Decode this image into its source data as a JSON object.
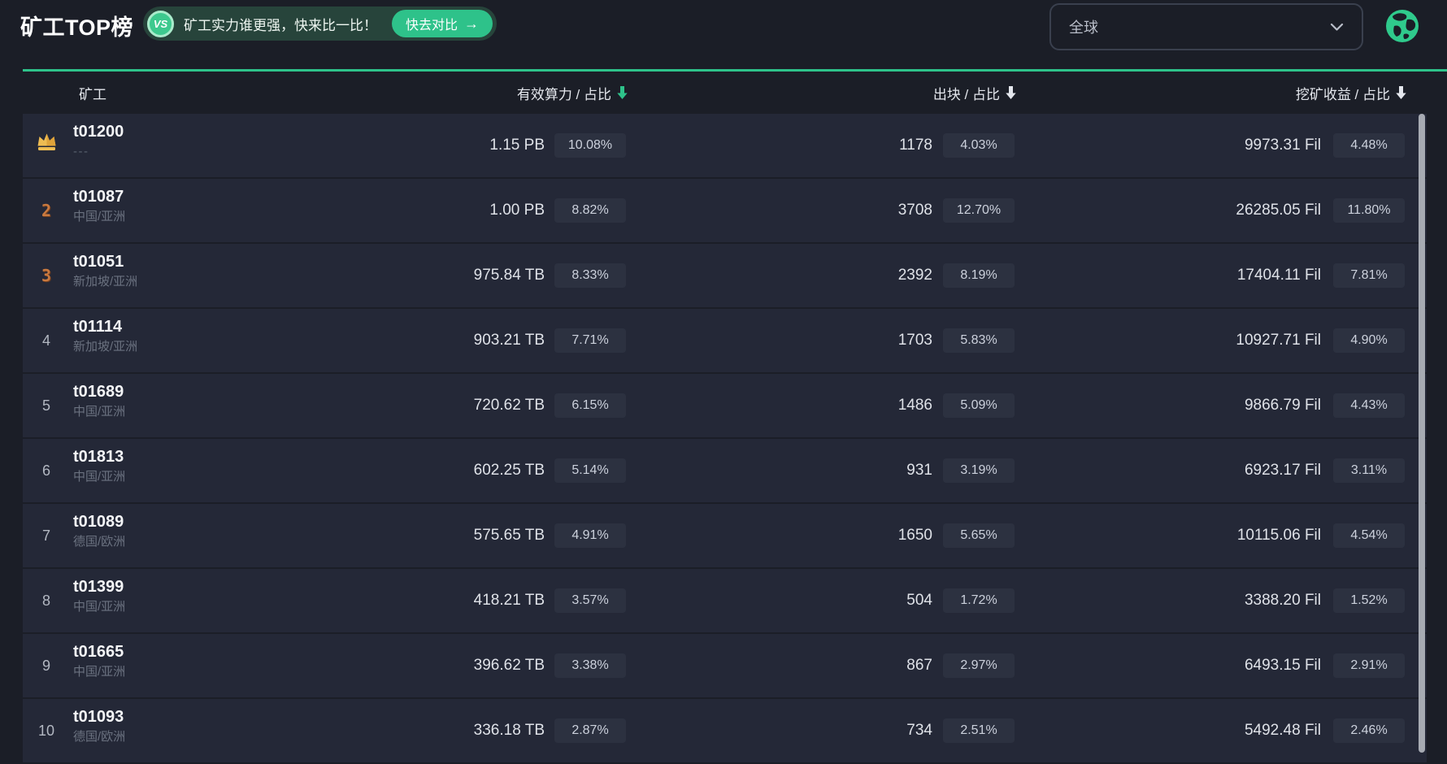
{
  "header": {
    "title": "矿工TOP榜",
    "promo": {
      "badge": "VS",
      "text": "矿工实力谁更强，快来比一比！",
      "button_label": "快去对比",
      "button_arrow": "→"
    },
    "region_select": {
      "value": "全球"
    }
  },
  "table": {
    "columns": [
      {
        "label": "矿工",
        "sorted": false
      },
      {
        "label": "有效算力 / 占比",
        "sorted": true
      },
      {
        "label": "出块 / 占比",
        "sorted": false
      },
      {
        "label": "挖矿收益 / 占比",
        "sorted": false
      }
    ],
    "rows": [
      {
        "rank": 1,
        "miner": "t01200",
        "location": "---",
        "power": "1.15 PB",
        "power_pct": "10.08%",
        "blocks": "1178",
        "blocks_pct": "4.03%",
        "reward": "9973.31 Fil",
        "reward_pct": "4.48%"
      },
      {
        "rank": 2,
        "miner": "t01087",
        "location": "中国/亚洲",
        "power": "1.00 PB",
        "power_pct": "8.82%",
        "blocks": "3708",
        "blocks_pct": "12.70%",
        "reward": "26285.05 Fil",
        "reward_pct": "11.80%"
      },
      {
        "rank": 3,
        "miner": "t01051",
        "location": "新加坡/亚洲",
        "power": "975.84 TB",
        "power_pct": "8.33%",
        "blocks": "2392",
        "blocks_pct": "8.19%",
        "reward": "17404.11 Fil",
        "reward_pct": "7.81%"
      },
      {
        "rank": 4,
        "miner": "t01114",
        "location": "新加坡/亚洲",
        "power": "903.21 TB",
        "power_pct": "7.71%",
        "blocks": "1703",
        "blocks_pct": "5.83%",
        "reward": "10927.71 Fil",
        "reward_pct": "4.90%"
      },
      {
        "rank": 5,
        "miner": "t01689",
        "location": "中国/亚洲",
        "power": "720.62 TB",
        "power_pct": "6.15%",
        "blocks": "1486",
        "blocks_pct": "5.09%",
        "reward": "9866.79 Fil",
        "reward_pct": "4.43%"
      },
      {
        "rank": 6,
        "miner": "t01813",
        "location": "中国/亚洲",
        "power": "602.25 TB",
        "power_pct": "5.14%",
        "blocks": "931",
        "blocks_pct": "3.19%",
        "reward": "6923.17 Fil",
        "reward_pct": "3.11%"
      },
      {
        "rank": 7,
        "miner": "t01089",
        "location": "德国/欧洲",
        "power": "575.65 TB",
        "power_pct": "4.91%",
        "blocks": "1650",
        "blocks_pct": "5.65%",
        "reward": "10115.06 Fil",
        "reward_pct": "4.54%"
      },
      {
        "rank": 8,
        "miner": "t01399",
        "location": "中国/亚洲",
        "power": "418.21 TB",
        "power_pct": "3.57%",
        "blocks": "504",
        "blocks_pct": "1.72%",
        "reward": "3388.20 Fil",
        "reward_pct": "1.52%"
      },
      {
        "rank": 9,
        "miner": "t01665",
        "location": "中国/亚洲",
        "power": "396.62 TB",
        "power_pct": "3.38%",
        "blocks": "867",
        "blocks_pct": "2.97%",
        "reward": "6493.15 Fil",
        "reward_pct": "2.91%"
      },
      {
        "rank": 10,
        "miner": "t01093",
        "location": "德国/欧洲",
        "power": "336.18 TB",
        "power_pct": "2.87%",
        "blocks": "734",
        "blocks_pct": "2.51%",
        "reward": "5492.48 Fil",
        "reward_pct": "2.46%"
      }
    ]
  },
  "colors": {
    "accent_green": "#2ec28a",
    "promo_pill_bg": "#27443b",
    "page_bg": "#1b1e27",
    "row_bg": "#242837",
    "badge_bg": "#2c3140",
    "gold_crown": "#eebc52",
    "bronze_rank": "#c9793f"
  }
}
